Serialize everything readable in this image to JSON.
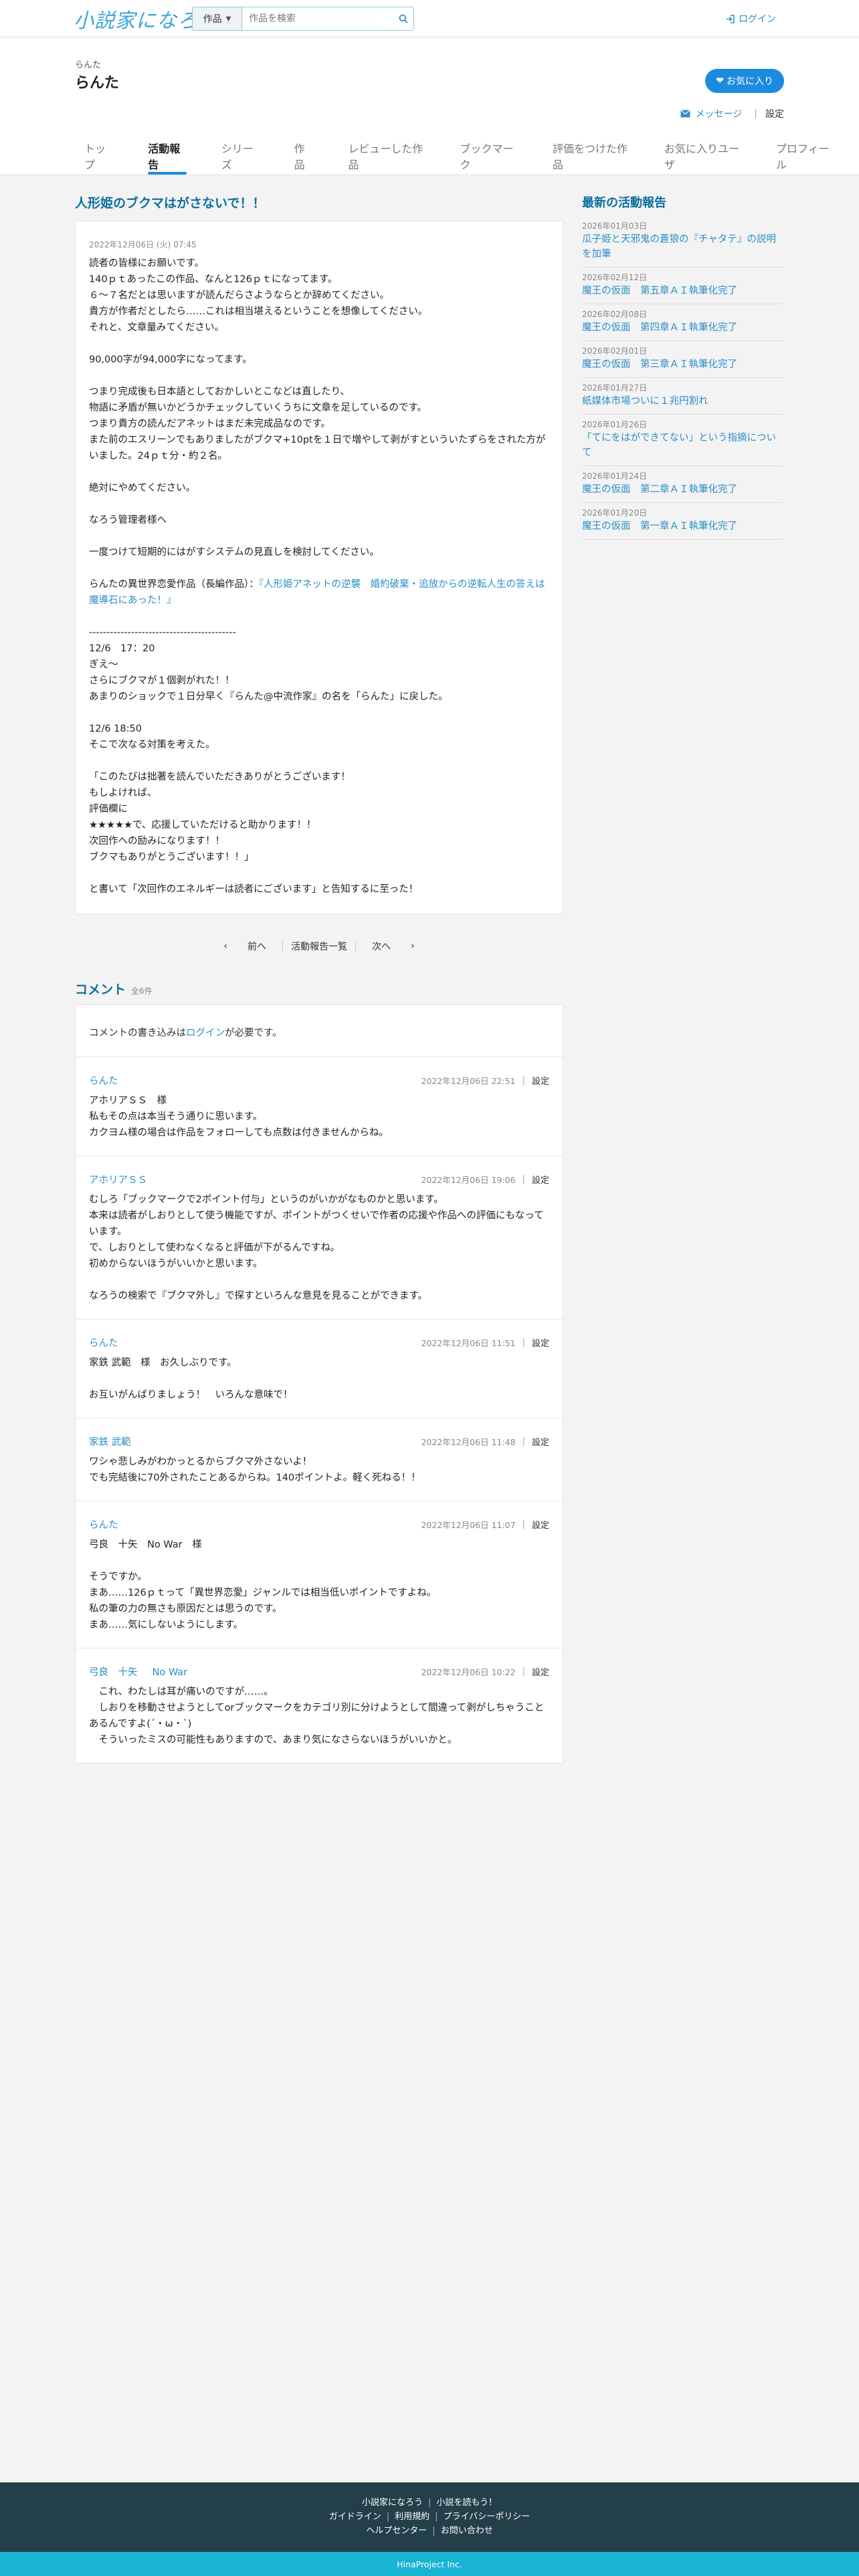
{
  "header": {
    "logo": "小説家になろう",
    "search_select": "作品",
    "search_placeholder": "作品を検索",
    "login": "ログイン"
  },
  "profile": {
    "kana": "らんた",
    "name": "らんた",
    "favorite_button": "お気に入り",
    "message": "メッセージ",
    "settings": "設定",
    "tabs": [
      {
        "label": "トップ",
        "active": false
      },
      {
        "label": "活動報告",
        "active": true
      },
      {
        "label": "シリーズ",
        "active": false
      },
      {
        "label": "作品",
        "active": false
      },
      {
        "label": "レビューした作品",
        "active": false
      },
      {
        "label": "ブックマーク",
        "active": false
      },
      {
        "label": "評価をつけた作品",
        "active": false
      },
      {
        "label": "お気に入りユーザ",
        "active": false
      },
      {
        "label": "プロフィール",
        "active": false
      }
    ]
  },
  "report": {
    "title": "人形姫のブクマはがさないで！！",
    "date": "2022年12月06日 (火) 07:45",
    "lines": [
      "読者の皆様にお願いです。",
      "140ｐｔあったこの作品、なんと126ｐｔになってます。",
      "６～７名だとは思いますが読んだらさようならとか辞めてください。",
      "貴方が作者だとしたら……これは相当堪えるということを想像してください。",
      "それと、文章量みてください。",
      "",
      "90,000字が94,000字になってます。",
      "",
      "つまり完成後も日本語としておかしいとこなどは直したり、",
      "物語に矛盾が無いかどうかチェックしていくうちに文章を足しているのです。",
      "つまり貴方の読んだアネットはまだ未完成品なのです。",
      "また前のエスリーンでもありましたがブクマ+10ptを１日で増やして剥がすといういたずらをされた方がいました。24ｐｔ分・約２名。",
      "",
      "絶対にやめてください。",
      "",
      "なろう管理者様へ",
      "",
      "一度つけて短期的にはがすシステムの見直しを検討してください。",
      "",
      "らんたの異世界恋愛作品（長編作品）：",
      "",
      "------------------------------------------",
      "12/6　17：20",
      "ぎえ～",
      "さらにブクマが１個剥がれた！！",
      "あまりのショックで１日分早く『らんた@中流作家』の名を「らんた」に戻した。",
      "",
      "12/6 18:50",
      "そこで次なる対策を考えた。",
      "",
      "「このたびは拙著を読んでいただきありがとうございます！",
      "もしよければ、",
      "評価欄に",
      "★★★★★で、応援していただけると助かります！！",
      "次回作への励みになります！！",
      "ブクマもありがとうございます！！」",
      "",
      "と書いて「次回作のエネルギーは読者にございます」と告知するに至った！"
    ],
    "link_text": "『人形姫アネットの逆襲　婚約破棄・追放からの逆転人生の答えは魔導石にあった！』"
  },
  "pager": {
    "prev": "前へ",
    "list": "活動報告一覧",
    "next": "次へ"
  },
  "comments": {
    "title": "コメント",
    "count": "全6件",
    "notice_prefix": "コメントの書き込みは",
    "notice_link": "ログイン",
    "notice_suffix": "が必要です。",
    "settings_label": "設定",
    "items": [
      {
        "author": "らんた",
        "author_extra": "",
        "date": "2022年12月06日 22:51",
        "lines": [
          "アホリアＳＳ　様",
          "私もその点は本当そう通りに思います。",
          "カクヨム様の場合は作品をフォローしても点数は付きませんからね。"
        ]
      },
      {
        "author": "アホリアＳＳ",
        "author_extra": "",
        "date": "2022年12月06日 19:06",
        "lines": [
          "むしろ「ブックマークで2ポイント付与」というのがいかがなものかと思います。",
          "本来は読者がしおりとして使う機能ですが、ポイントがつくせいで作者の応援や作品への評価にもなっています。",
          "で、しおりとして使わなくなると評価が下がるんですね。",
          "初めからないほうがいいかと思います。",
          "",
          "なろうの検索で『ブクマ外し』で探すといろんな意見を見ることができます。"
        ]
      },
      {
        "author": "らんた",
        "author_extra": "",
        "date": "2022年12月06日 11:51",
        "lines": [
          "家鉄 武範　様　お久しぶりです。",
          "",
          "お互いがんばりましょう！　いろんな意味で！"
        ]
      },
      {
        "author": "家鉄 武範",
        "author_extra": "",
        "date": "2022年12月06日 11:48",
        "lines": [
          "ワシゃ悲しみがわかっとるからブクマ外さないよ！",
          "でも完結後に70外されたことあるからね。140ポイントよ。軽く死ねる！！"
        ]
      },
      {
        "author": "らんた",
        "author_extra": "",
        "date": "2022年12月06日 11:07",
        "lines": [
          "弓良　十矢　No War　様",
          "",
          "そうですか。",
          "まあ……126ｐｔって「異世界恋愛」ジャンルでは相当低いポイントですよね。",
          "私の筆の力の無さも原因だとは思うのです。",
          "まあ……気にしないようにします。"
        ]
      },
      {
        "author": "弓良　十矢",
        "author_extra": "No War",
        "date": "2022年12月06日 10:22",
        "lines": [
          "　これ、わたしは耳が痛いのですが……。",
          "　しおりを移動させようとしてorブックマークをカテゴリ別に分けようとして間違って剥がしちゃうことあるんですよ(´・ω・`)",
          "　そういったミスの可能性もありますので、あまり気になさらないほうがいいかと。"
        ]
      }
    ]
  },
  "sidebar": {
    "title": "最新の活動報告",
    "items": [
      {
        "date": "2026年01月03日",
        "title": "瓜子姫と天邪鬼の蒼狼の『チャタテ』の説明を加筆"
      },
      {
        "date": "2026年02月12日",
        "title": "魔王の仮面　第五章ＡＩ執筆化完了"
      },
      {
        "date": "2026年02月08日",
        "title": "魔王の仮面　第四章ＡＩ執筆化完了"
      },
      {
        "date": "2026年02月01日",
        "title": "魔王の仮面　第三章ＡＩ執筆化完了"
      },
      {
        "date": "2026年01月27日",
        "title": "紙媒体市場ついに１兆円割れ"
      },
      {
        "date": "2026年01月26日",
        "title": "「てにをはができてない」という指摘について"
      },
      {
        "date": "2026年01月24日",
        "title": "魔王の仮面　第二章ＡＩ執筆化完了"
      },
      {
        "date": "2026年01月20日",
        "title": "魔王の仮面　第一章ＡＩ執筆化完了"
      }
    ]
  },
  "footer": {
    "row1": [
      "小説家になろう",
      "小説を読もう！"
    ],
    "row2": [
      "ガイドライン",
      "利用規約",
      "プライバシーポリシー"
    ],
    "row3": [
      "ヘルプセンター",
      "お問い合わせ"
    ],
    "copyright": "HinaProject Inc."
  },
  "colors": {
    "accent": "#1b8be0",
    "link": "#2b8ec9",
    "heading": "#0c6f9c",
    "footer_bg": "#233f4a",
    "copyright_bg": "#19b3d3"
  }
}
